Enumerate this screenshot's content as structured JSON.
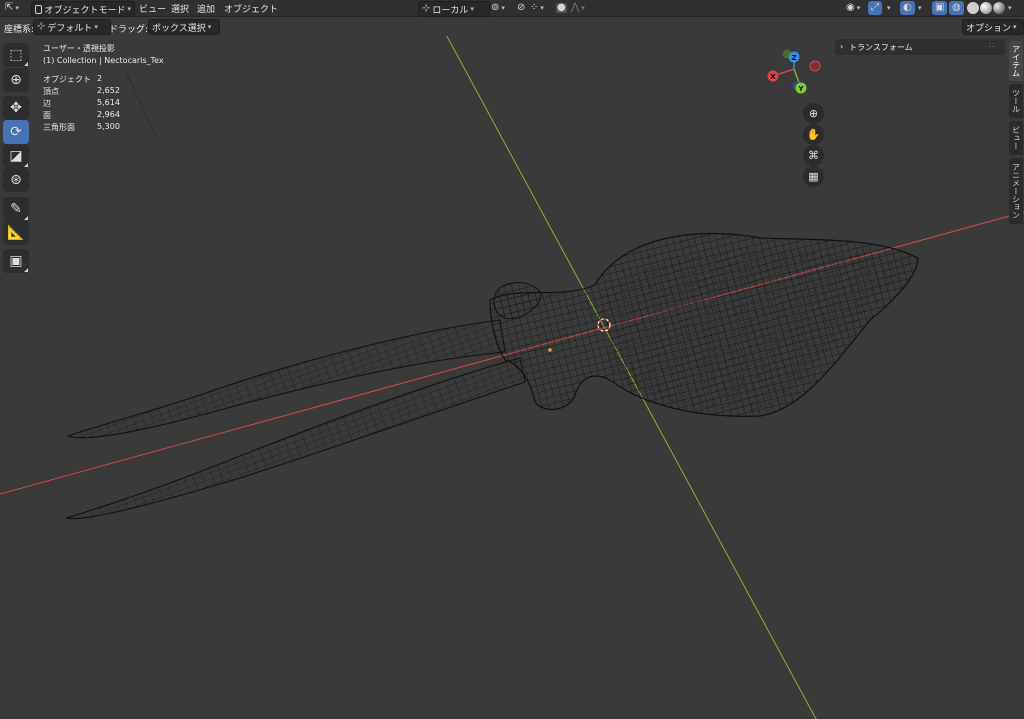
{
  "header": {
    "mode_label": "オブジェクトモード",
    "menu": [
      "ビュー",
      "選択",
      "追加",
      "オブジェクト"
    ],
    "transform_orientation": "ローカル",
    "options_label": "オプション"
  },
  "subheader": {
    "orientation_label": "座標系:",
    "orientation_value": "デフォルト",
    "drag_label": "ドラッグ:",
    "drag_value": "ボックス選択"
  },
  "overlay": {
    "view_name": "ユーザー・透視投影",
    "collection_line": "(1) Collection | Nectocaris_Tex",
    "stats": [
      {
        "label": "オブジェクト",
        "value": "2"
      },
      {
        "label": "頂点",
        "value": "2,652"
      },
      {
        "label": "辺",
        "value": "5,614"
      },
      {
        "label": "面",
        "value": "2,964"
      },
      {
        "label": "三角形面",
        "value": "5,300"
      }
    ]
  },
  "gizmo": {
    "x": "X",
    "y": "Y",
    "z": "Z"
  },
  "npanel": {
    "transform_label": "トランスフォーム",
    "tabs": [
      "アイテム",
      "ツール",
      "ビュー",
      "アニメーション"
    ]
  },
  "colors": {
    "accent": "#4772b3",
    "axis_x": "#c94a4a",
    "axis_y": "#7fb52e",
    "axis_z": "#3c8fe0",
    "viewport": "#3a3a3a"
  },
  "icons": {
    "tools": [
      "select-box-icon",
      "cursor-icon",
      "move-icon",
      "rotate-icon",
      "scale-icon",
      "transform-icon",
      "annotate-icon",
      "measure-icon",
      "add-cube-icon"
    ],
    "nav": [
      "zoom-icon",
      "hand-pan-icon",
      "camera-icon",
      "grid-perspective-icon"
    ]
  }
}
